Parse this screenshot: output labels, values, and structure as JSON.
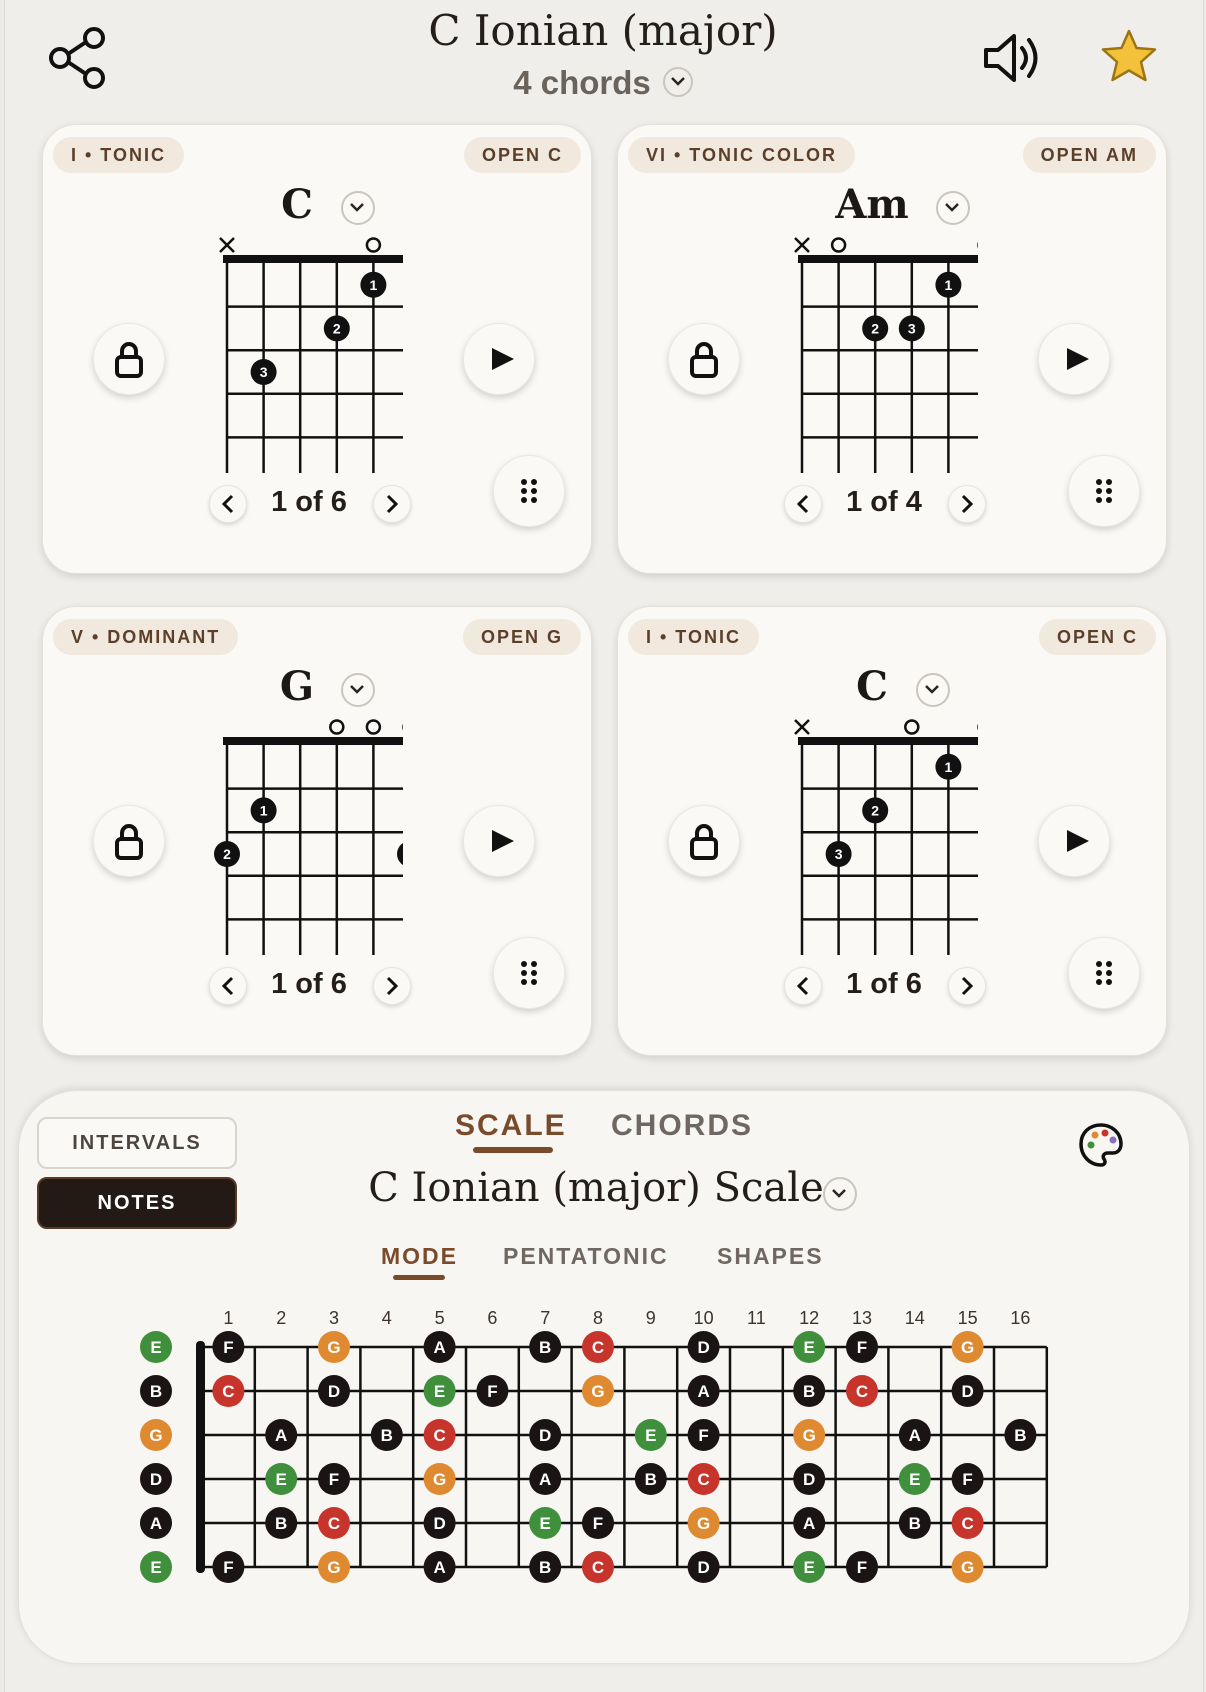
{
  "header": {
    "title": "C Ionian (major)",
    "subtitle": "4 chords"
  },
  "cards": [
    {
      "degree": "I • TONIC",
      "voicing": "OPEN C",
      "chord": "C",
      "pager": "1 of 6",
      "markers": [
        "x",
        "",
        "",
        "",
        "o",
        "",
        "o"
      ],
      "dots": [
        {
          "string": 5,
          "fret": 1,
          "finger": "1"
        },
        {
          "string": 4,
          "fret": 2,
          "finger": "2"
        },
        {
          "string": 2,
          "fret": 3,
          "finger": "3"
        }
      ]
    },
    {
      "degree": "VI • TONIC COLOR",
      "voicing": "OPEN AM",
      "chord": "Am",
      "pager": "1 of 4",
      "markers": [
        "x",
        "o",
        "",
        "",
        "",
        "o"
      ],
      "dots": [
        {
          "string": 5,
          "fret": 1,
          "finger": "1"
        },
        {
          "string": 3,
          "fret": 2,
          "finger": "2"
        },
        {
          "string": 4,
          "fret": 2,
          "finger": "3"
        }
      ]
    },
    {
      "degree": "V • DOMINANT",
      "voicing": "OPEN G",
      "chord": "G",
      "pager": "1 of 6",
      "markers": [
        "",
        "",
        "",
        "o",
        "o",
        "o"
      ],
      "dots": [
        {
          "string": 2,
          "fret": 2,
          "finger": "1"
        },
        {
          "string": 1,
          "fret": 3,
          "finger": "2"
        },
        {
          "string": 6,
          "fret": 3,
          "finger": "3"
        }
      ]
    },
    {
      "degree": "I • TONIC",
      "voicing": "OPEN C",
      "chord": "C",
      "pager": "1 of 6",
      "markers": [
        "x",
        "",
        "",
        "o",
        "",
        "o"
      ],
      "dots": [
        {
          "string": 5,
          "fret": 1,
          "finger": "1"
        },
        {
          "string": 3,
          "fret": 2,
          "finger": "2"
        },
        {
          "string": 2,
          "fret": 3,
          "finger": "3"
        }
      ]
    }
  ],
  "panel": {
    "toggle_intervals": "INTERVALS",
    "toggle_notes": "NOTES",
    "tab_scale": "SCALE",
    "tab_chords": "CHORDS",
    "scale_title": "C Ionian (major) Scale",
    "subtab_mode": "MODE",
    "subtab_pentatonic": "PENTATONIC",
    "subtab_shapes": "SHAPES"
  },
  "colors": {
    "accent": "#7a4b2b",
    "note_black": "#1a1514",
    "note_red": "#c7342c",
    "note_green": "#3f8f3c",
    "note_orange": "#df8a30"
  },
  "fretboard": {
    "fret_numbers": [
      "1",
      "2",
      "3",
      "4",
      "5",
      "6",
      "7",
      "8",
      "9",
      "10",
      "11",
      "12",
      "13",
      "14",
      "15",
      "16"
    ],
    "open_strings": [
      {
        "note": "E",
        "color": "green"
      },
      {
        "note": "B",
        "color": "black"
      },
      {
        "note": "G",
        "color": "orange"
      },
      {
        "note": "D",
        "color": "black"
      },
      {
        "note": "A",
        "color": "black"
      },
      {
        "note": "E",
        "color": "green"
      }
    ],
    "rows": [
      [
        {
          "f": 1,
          "n": "F",
          "c": "black"
        },
        {
          "f": 3,
          "n": "G",
          "c": "orange"
        },
        {
          "f": 5,
          "n": "A",
          "c": "black"
        },
        {
          "f": 7,
          "n": "B",
          "c": "black"
        },
        {
          "f": 8,
          "n": "C",
          "c": "red"
        },
        {
          "f": 10,
          "n": "D",
          "c": "black"
        },
        {
          "f": 12,
          "n": "E",
          "c": "green"
        },
        {
          "f": 13,
          "n": "F",
          "c": "black"
        },
        {
          "f": 15,
          "n": "G",
          "c": "orange"
        }
      ],
      [
        {
          "f": 1,
          "n": "C",
          "c": "red"
        },
        {
          "f": 3,
          "n": "D",
          "c": "black"
        },
        {
          "f": 5,
          "n": "E",
          "c": "green"
        },
        {
          "f": 6,
          "n": "F",
          "c": "black"
        },
        {
          "f": 8,
          "n": "G",
          "c": "orange"
        },
        {
          "f": 10,
          "n": "A",
          "c": "black"
        },
        {
          "f": 12,
          "n": "B",
          "c": "black"
        },
        {
          "f": 13,
          "n": "C",
          "c": "red"
        },
        {
          "f": 15,
          "n": "D",
          "c": "black"
        }
      ],
      [
        {
          "f": 2,
          "n": "A",
          "c": "black"
        },
        {
          "f": 4,
          "n": "B",
          "c": "black"
        },
        {
          "f": 5,
          "n": "C",
          "c": "red"
        },
        {
          "f": 7,
          "n": "D",
          "c": "black"
        },
        {
          "f": 9,
          "n": "E",
          "c": "green"
        },
        {
          "f": 10,
          "n": "F",
          "c": "black"
        },
        {
          "f": 12,
          "n": "G",
          "c": "orange"
        },
        {
          "f": 14,
          "n": "A",
          "c": "black"
        },
        {
          "f": 16,
          "n": "B",
          "c": "black"
        }
      ],
      [
        {
          "f": 2,
          "n": "E",
          "c": "green"
        },
        {
          "f": 3,
          "n": "F",
          "c": "black"
        },
        {
          "f": 5,
          "n": "G",
          "c": "orange"
        },
        {
          "f": 7,
          "n": "A",
          "c": "black"
        },
        {
          "f": 9,
          "n": "B",
          "c": "black"
        },
        {
          "f": 10,
          "n": "C",
          "c": "red"
        },
        {
          "f": 12,
          "n": "D",
          "c": "black"
        },
        {
          "f": 14,
          "n": "E",
          "c": "green"
        },
        {
          "f": 15,
          "n": "F",
          "c": "black"
        }
      ],
      [
        {
          "f": 2,
          "n": "B",
          "c": "black"
        },
        {
          "f": 3,
          "n": "C",
          "c": "red"
        },
        {
          "f": 5,
          "n": "D",
          "c": "black"
        },
        {
          "f": 7,
          "n": "E",
          "c": "green"
        },
        {
          "f": 8,
          "n": "F",
          "c": "black"
        },
        {
          "f": 10,
          "n": "G",
          "c": "orange"
        },
        {
          "f": 12,
          "n": "A",
          "c": "black"
        },
        {
          "f": 14,
          "n": "B",
          "c": "black"
        },
        {
          "f": 15,
          "n": "C",
          "c": "red"
        }
      ],
      [
        {
          "f": 1,
          "n": "F",
          "c": "black"
        },
        {
          "f": 3,
          "n": "G",
          "c": "orange"
        },
        {
          "f": 5,
          "n": "A",
          "c": "black"
        },
        {
          "f": 7,
          "n": "B",
          "c": "black"
        },
        {
          "f": 8,
          "n": "C",
          "c": "red"
        },
        {
          "f": 10,
          "n": "D",
          "c": "black"
        },
        {
          "f": 12,
          "n": "E",
          "c": "green"
        },
        {
          "f": 13,
          "n": "F",
          "c": "black"
        },
        {
          "f": 15,
          "n": "G",
          "c": "orange"
        }
      ]
    ]
  }
}
